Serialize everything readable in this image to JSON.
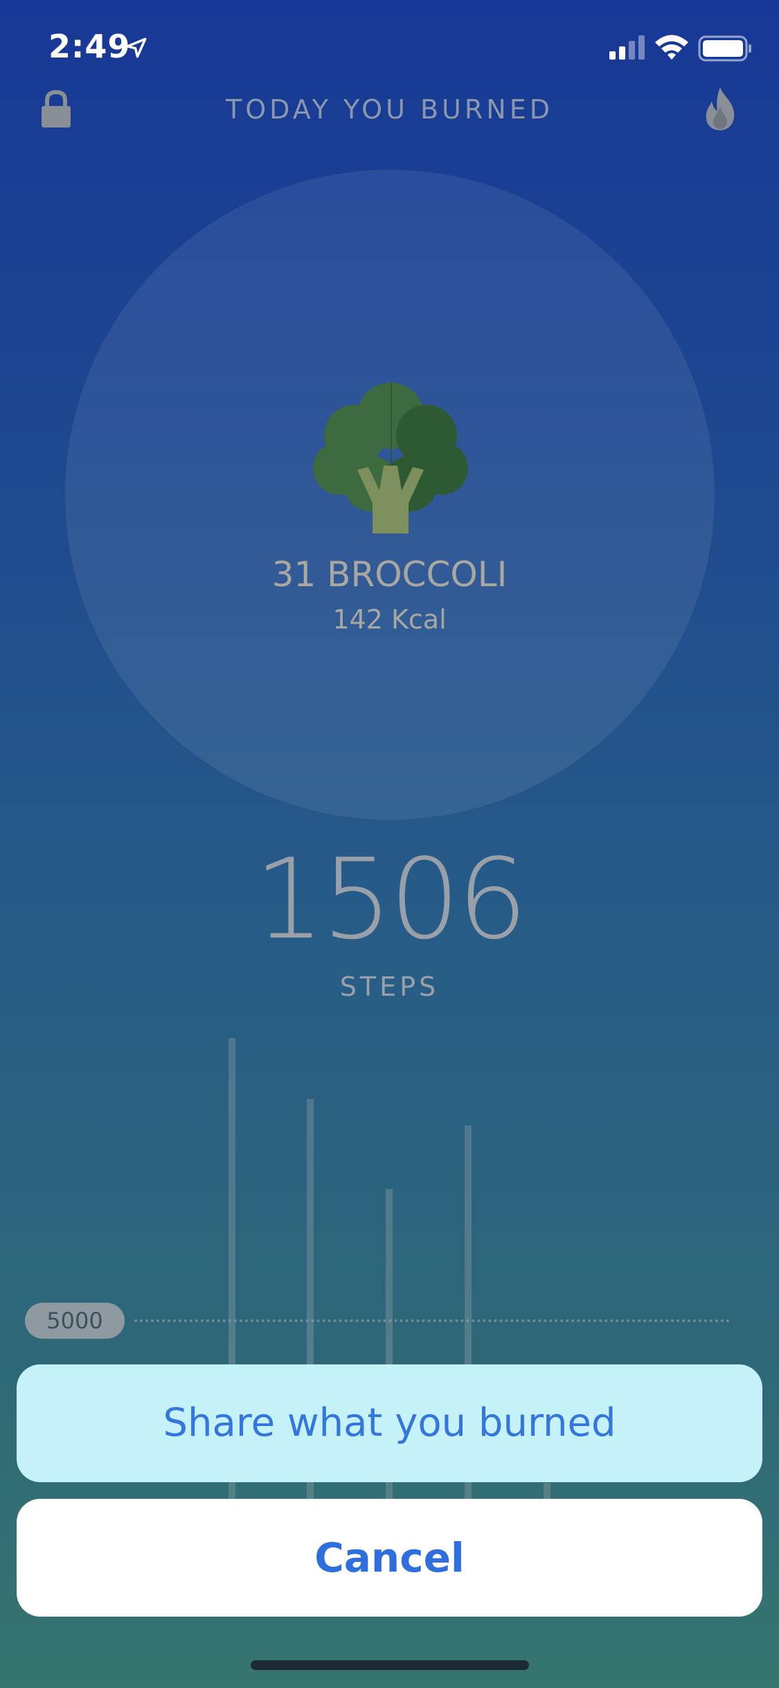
{
  "status_bar": {
    "time": "2:49",
    "location_icon": "location-arrow-icon",
    "signal_icon": "cellular-signal-icon",
    "wifi_icon": "wifi-icon",
    "battery_icon": "battery-icon"
  },
  "header": {
    "title": "TODAY YOU BURNED",
    "left_icon": "lock-icon",
    "right_icon": "flame-icon"
  },
  "summary": {
    "food_icon": "broccoli-icon",
    "food_count": "31 BROCCOLI",
    "kcal": "142 Kcal"
  },
  "steps": {
    "count": "1506",
    "label": "STEPS"
  },
  "chart_data": {
    "type": "bar",
    "goal_label": "5000",
    "goal_value": 5000
  },
  "action_sheet": {
    "share_label": "Share what you burned",
    "cancel_label": "Cancel"
  },
  "colors": {
    "share_text": "#3575de",
    "share_bg": "#c4f2f8",
    "cancel_text": "#2f6fdd"
  }
}
